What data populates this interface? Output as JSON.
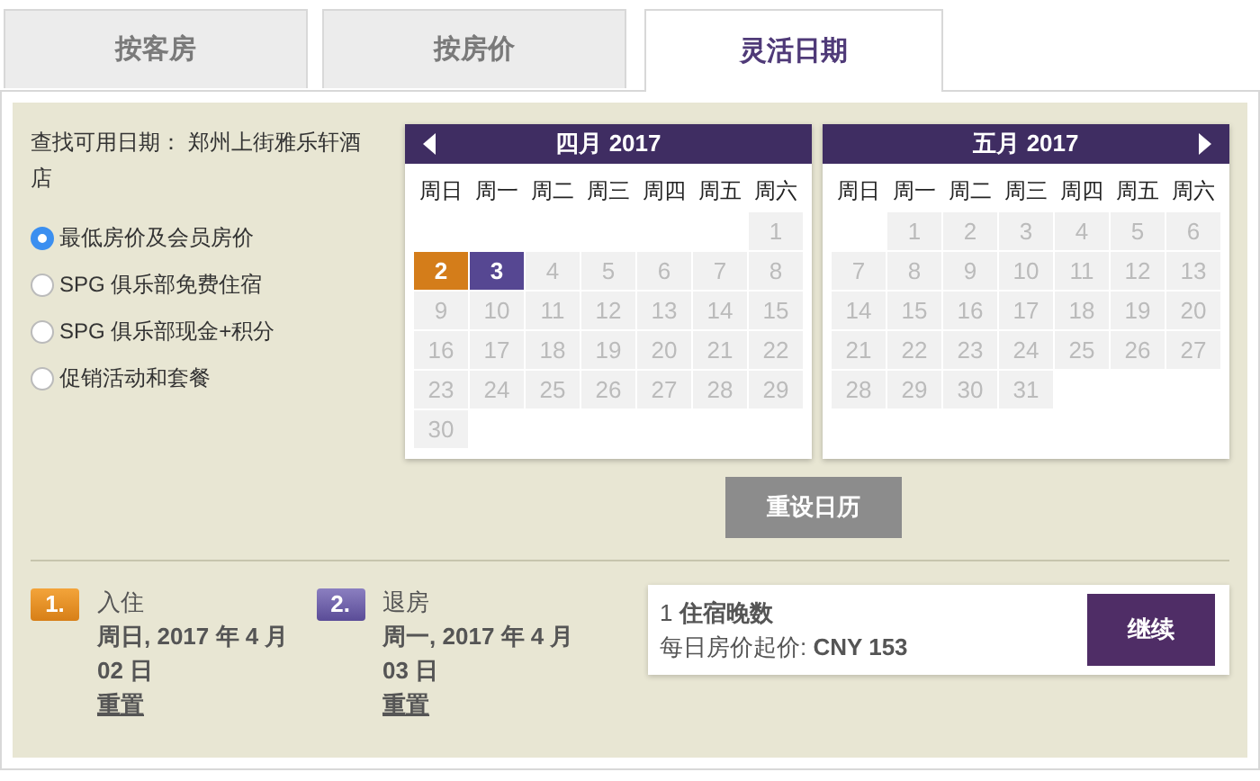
{
  "tabs": [
    {
      "label": "按客房",
      "selected": false
    },
    {
      "label": "按房价",
      "selected": false
    },
    {
      "label": "灵活日期",
      "selected": true
    }
  ],
  "search_label": "查找可用日期： 郑州上街雅乐轩酒店",
  "rate_options": [
    {
      "label": "最低房价及会员房价",
      "selected": true
    },
    {
      "label": "SPG 俱乐部免费住宿",
      "selected": false
    },
    {
      "label": "SPG 俱乐部现金+积分",
      "selected": false
    },
    {
      "label": "促销活动和套餐",
      "selected": false
    }
  ],
  "calendars": [
    {
      "title": "四月 2017",
      "prev_arrow": true,
      "next_arrow": false,
      "weekdays": [
        "周日",
        "周一",
        "周二",
        "周三",
        "周四",
        "周五",
        "周六"
      ],
      "days": [
        {
          "kind": "blank"
        },
        {
          "kind": "blank"
        },
        {
          "kind": "blank"
        },
        {
          "kind": "blank"
        },
        {
          "kind": "blank"
        },
        {
          "kind": "blank"
        },
        {
          "day": "1",
          "kind": "unavailable"
        },
        {
          "day": "2",
          "kind": "checkin"
        },
        {
          "day": "3",
          "kind": "checkout"
        },
        {
          "day": "4",
          "kind": "unavailable"
        },
        {
          "day": "5",
          "kind": "unavailable"
        },
        {
          "day": "6",
          "kind": "unavailable"
        },
        {
          "day": "7",
          "kind": "unavailable"
        },
        {
          "day": "8",
          "kind": "unavailable"
        },
        {
          "day": "9",
          "kind": "unavailable"
        },
        {
          "day": "10",
          "kind": "unavailable"
        },
        {
          "day": "11",
          "kind": "unavailable"
        },
        {
          "day": "12",
          "kind": "unavailable"
        },
        {
          "day": "13",
          "kind": "unavailable"
        },
        {
          "day": "14",
          "kind": "unavailable"
        },
        {
          "day": "15",
          "kind": "unavailable"
        },
        {
          "day": "16",
          "kind": "unavailable"
        },
        {
          "day": "17",
          "kind": "unavailable"
        },
        {
          "day": "18",
          "kind": "unavailable"
        },
        {
          "day": "19",
          "kind": "unavailable"
        },
        {
          "day": "20",
          "kind": "unavailable"
        },
        {
          "day": "21",
          "kind": "unavailable"
        },
        {
          "day": "22",
          "kind": "unavailable"
        },
        {
          "day": "23",
          "kind": "unavailable"
        },
        {
          "day": "24",
          "kind": "unavailable"
        },
        {
          "day": "25",
          "kind": "unavailable"
        },
        {
          "day": "26",
          "kind": "unavailable"
        },
        {
          "day": "27",
          "kind": "unavailable"
        },
        {
          "day": "28",
          "kind": "unavailable"
        },
        {
          "day": "29",
          "kind": "unavailable"
        },
        {
          "day": "30",
          "kind": "unavailable"
        }
      ]
    },
    {
      "title": "五月 2017",
      "prev_arrow": false,
      "next_arrow": true,
      "weekdays": [
        "周日",
        "周一",
        "周二",
        "周三",
        "周四",
        "周五",
        "周六"
      ],
      "days": [
        {
          "kind": "blank"
        },
        {
          "day": "1",
          "kind": "unavailable"
        },
        {
          "day": "2",
          "kind": "unavailable"
        },
        {
          "day": "3",
          "kind": "unavailable"
        },
        {
          "day": "4",
          "kind": "unavailable"
        },
        {
          "day": "5",
          "kind": "unavailable"
        },
        {
          "day": "6",
          "kind": "unavailable"
        },
        {
          "day": "7",
          "kind": "unavailable"
        },
        {
          "day": "8",
          "kind": "unavailable"
        },
        {
          "day": "9",
          "kind": "unavailable"
        },
        {
          "day": "10",
          "kind": "unavailable"
        },
        {
          "day": "11",
          "kind": "unavailable"
        },
        {
          "day": "12",
          "kind": "unavailable"
        },
        {
          "day": "13",
          "kind": "unavailable"
        },
        {
          "day": "14",
          "kind": "unavailable"
        },
        {
          "day": "15",
          "kind": "unavailable"
        },
        {
          "day": "16",
          "kind": "unavailable"
        },
        {
          "day": "17",
          "kind": "unavailable"
        },
        {
          "day": "18",
          "kind": "unavailable"
        },
        {
          "day": "19",
          "kind": "unavailable"
        },
        {
          "day": "20",
          "kind": "unavailable"
        },
        {
          "day": "21",
          "kind": "unavailable"
        },
        {
          "day": "22",
          "kind": "unavailable"
        },
        {
          "day": "23",
          "kind": "unavailable"
        },
        {
          "day": "24",
          "kind": "unavailable"
        },
        {
          "day": "25",
          "kind": "unavailable"
        },
        {
          "day": "26",
          "kind": "unavailable"
        },
        {
          "day": "27",
          "kind": "unavailable"
        },
        {
          "day": "28",
          "kind": "unavailable"
        },
        {
          "day": "29",
          "kind": "unavailable"
        },
        {
          "day": "30",
          "kind": "unavailable"
        },
        {
          "day": "31",
          "kind": "unavailable"
        }
      ]
    }
  ],
  "reset_calendar_button": "重设日历",
  "steps": [
    {
      "badge": "1.",
      "kind": "checkin",
      "label": "入住",
      "date": "周日, 2017 年 4 月 02 日",
      "reset": "重置"
    },
    {
      "badge": "2.",
      "kind": "checkout",
      "label": "退房",
      "date": "周一, 2017 年 4 月 03 日",
      "reset": "重置"
    }
  ],
  "summary": {
    "nights": "1 **住宿晚数**",
    "rate": "每日房价起价: **CNY 153**",
    "button": "继续"
  }
}
